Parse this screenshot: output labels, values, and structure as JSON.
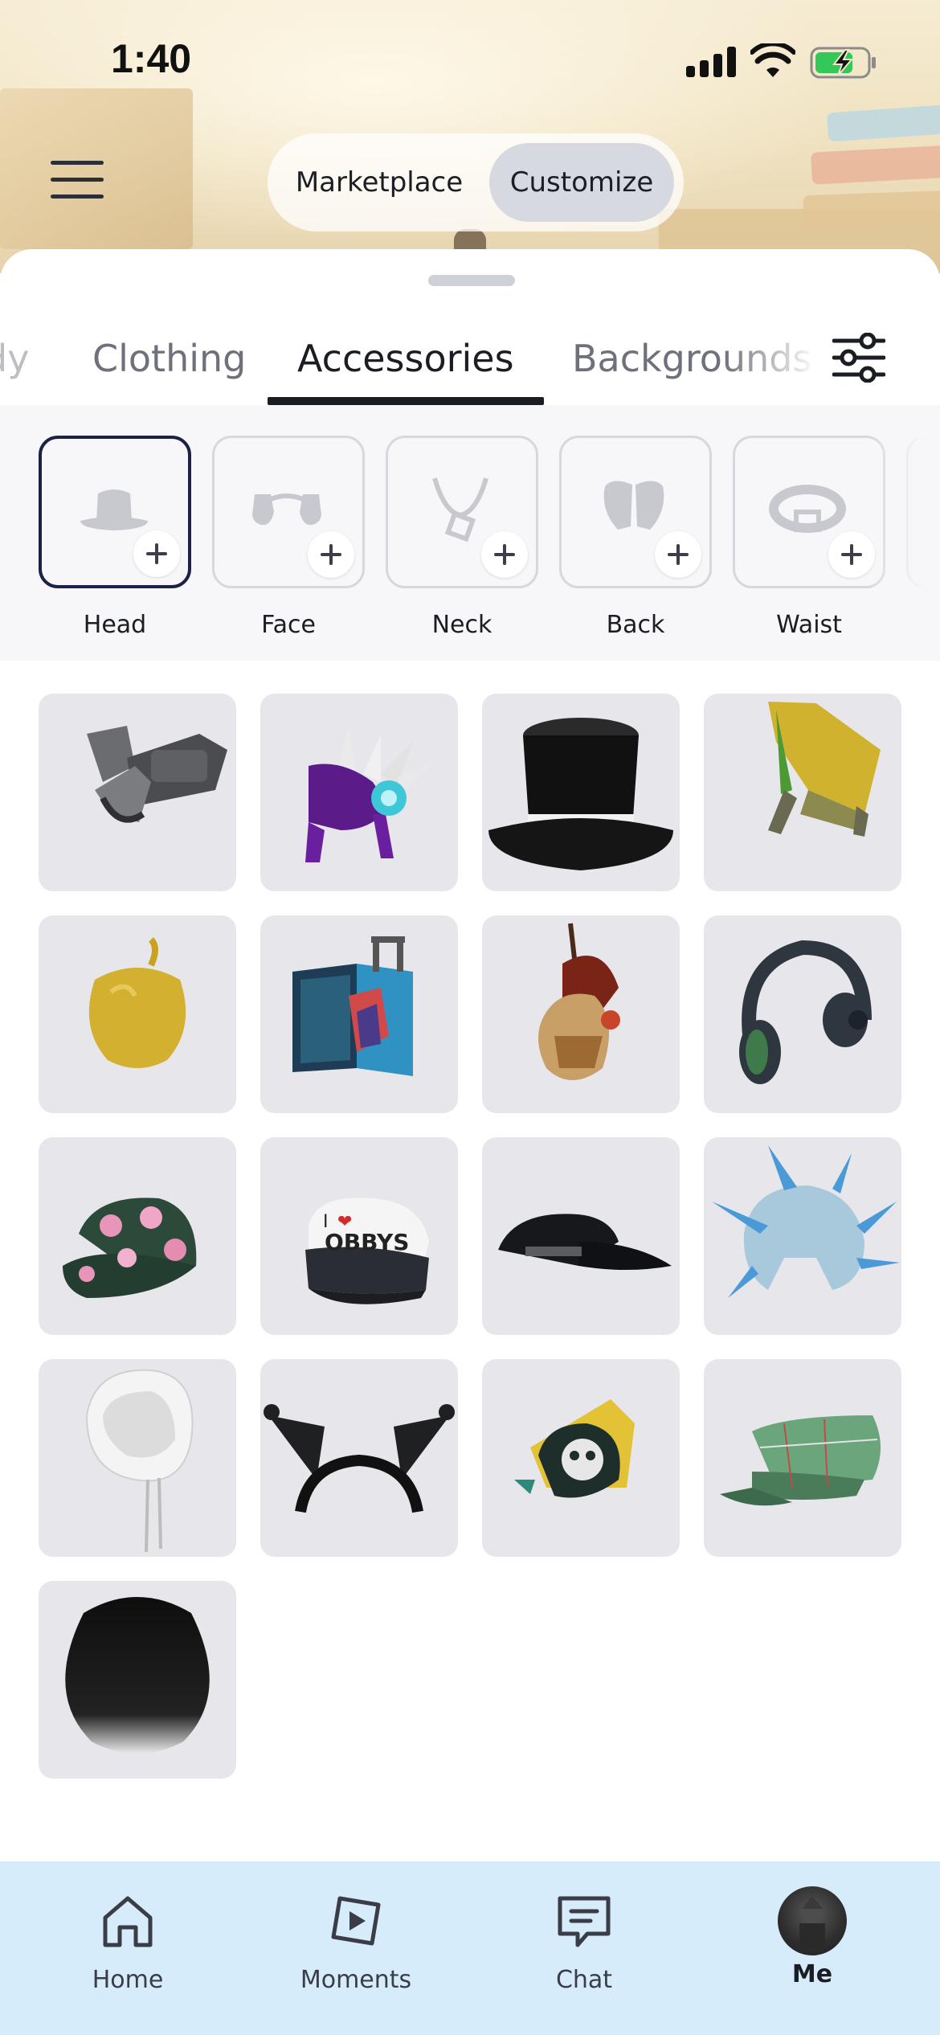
{
  "status_bar": {
    "time": "1:40"
  },
  "header": {
    "segments": [
      {
        "label": "Marketplace",
        "selected": false
      },
      {
        "label": "Customize",
        "selected": true
      }
    ]
  },
  "tabs": [
    {
      "label": "dy",
      "partial": true
    },
    {
      "label": "Clothing"
    },
    {
      "label": "Accessories",
      "active": true
    },
    {
      "label": "Backgrounds"
    }
  ],
  "categories": [
    {
      "label": "Head",
      "icon": "hat-icon",
      "selected": true
    },
    {
      "label": "Face",
      "icon": "glasses-icon"
    },
    {
      "label": "Neck",
      "icon": "necklace-icon"
    },
    {
      "label": "Back",
      "icon": "wings-icon"
    },
    {
      "label": "Waist",
      "icon": "belt-icon"
    }
  ],
  "items": [
    {
      "icon": "robot-arm-shoulder-icon"
    },
    {
      "icon": "purple-crystal-headband-icon"
    },
    {
      "icon": "top-hat-icon"
    },
    {
      "icon": "yellow-wing-icon"
    },
    {
      "icon": "golden-apple-icon"
    },
    {
      "icon": "suitcase-icon"
    },
    {
      "icon": "red-hair-helmet-icon"
    },
    {
      "icon": "headphones-icon"
    },
    {
      "icon": "floral-cap-icon"
    },
    {
      "icon": "obbys-cap-icon",
      "text": "I ❤ OBBYS"
    },
    {
      "icon": "black-cap-icon"
    },
    {
      "icon": "spiky-helmet-icon"
    },
    {
      "icon": "white-hood-icon"
    },
    {
      "icon": "cat-ears-headband-icon"
    },
    {
      "icon": "skull-hat-icon"
    },
    {
      "icon": "green-plaid-cap-icon"
    },
    {
      "icon": "black-hair-icon"
    }
  ],
  "bottom_nav": [
    {
      "label": "Home",
      "icon": "home-icon"
    },
    {
      "label": "Moments",
      "icon": "play-icon"
    },
    {
      "label": "Chat",
      "icon": "chat-icon"
    },
    {
      "label": "Me",
      "icon": "avatar",
      "active": true
    }
  ],
  "colors": {
    "accent_dark": "#1b2245",
    "nav_background": "#d6ecfb",
    "tile_background": "#e6e6eb"
  }
}
